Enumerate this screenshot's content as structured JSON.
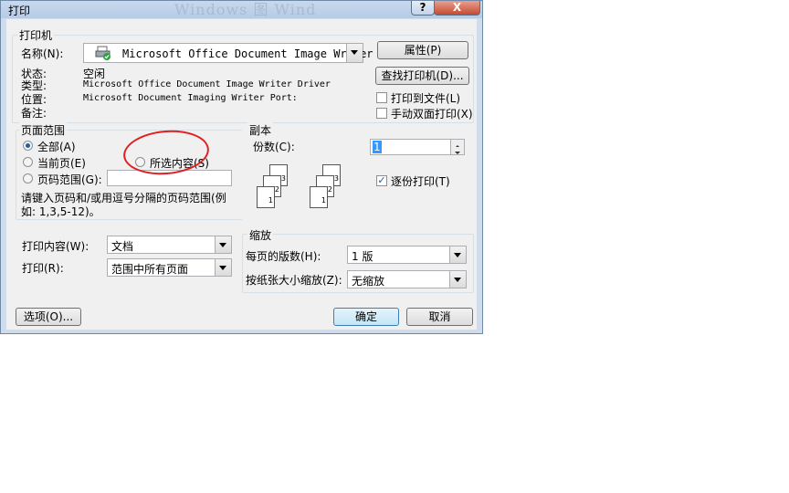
{
  "window": {
    "title": "打印",
    "ghost_title": "Windows 图 Wind",
    "help_label": "?",
    "close_label": "X"
  },
  "printer": {
    "group_label": "打印机",
    "name_label": "名称(N):",
    "name_value": "Microsoft Office Document Image Writer",
    "properties_label": "属性(P)",
    "status_label": "状态:",
    "status_value": "空闲",
    "type_label": "类型:",
    "type_value": "Microsoft Office Document Image Writer Driver",
    "where_label": "位置:",
    "where_value": "Microsoft Document Imaging Writer Port:",
    "comment_label": "备注:",
    "find_printer_label": "查找打印机(D)...",
    "print_to_file_label": "打印到文件(L)",
    "manual_duplex_label": "手动双面打印(X)"
  },
  "page_range": {
    "group_label": "页面范围",
    "all_label": "全部(A)",
    "current_label": "当前页(E)",
    "selection_label": "所选内容(S)",
    "pages_label": "页码范围(G):",
    "pages_value": "",
    "hint": "请键入页码和/或用逗号分隔的页码范围(例如: 1,3,5-12)。"
  },
  "copies": {
    "group_label": "副本",
    "count_label": "份数(C):",
    "count_value": "1",
    "collate_label": "逐份打印(T)",
    "page_numbers": [
      "1",
      "2",
      "3"
    ]
  },
  "print_what": {
    "label": "打印内容(W):",
    "value": "文档"
  },
  "print": {
    "label": "打印(R):",
    "value": "范围中所有页面"
  },
  "zoom": {
    "group_label": "缩放",
    "pages_per_sheet_label": "每页的版数(H):",
    "pages_per_sheet_value": "1 版",
    "scale_label": "按纸张大小缩放(Z):",
    "scale_value": "无缩放"
  },
  "buttons": {
    "options": "选项(O)...",
    "ok": "确定",
    "cancel": "取消"
  }
}
